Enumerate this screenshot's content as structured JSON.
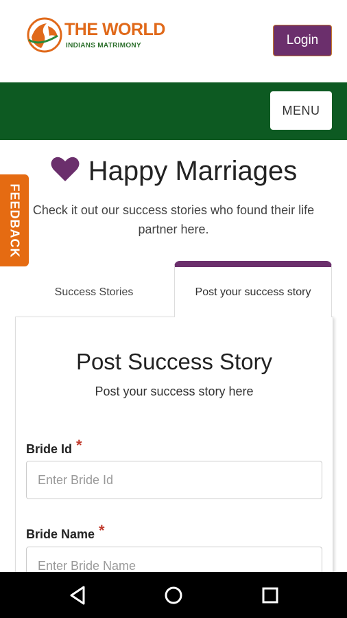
{
  "header": {
    "logo_title": "THE WORLD",
    "logo_subtitle": "INDIANS MATRIMONY",
    "login_label": "Login"
  },
  "navbar": {
    "menu_label": "MENU",
    "color": "#0d5a22"
  },
  "feedback_label": "FEEDBACK",
  "hero": {
    "title": "Happy Marriages",
    "subtitle": "Check it out our success stories who found their life partner here."
  },
  "tabs": [
    {
      "label": "Success Stories",
      "active": false
    },
    {
      "label": "Post your success story",
      "active": true
    }
  ],
  "form": {
    "title": "Post Success Story",
    "subtitle": "Post your success story here",
    "fields": [
      {
        "label": "Bride Id",
        "required_mark": "*",
        "placeholder": "Enter Bride Id",
        "value": ""
      },
      {
        "label": "Bride Name",
        "required_mark": "*",
        "placeholder": "Enter Bride Name",
        "value": ""
      }
    ]
  },
  "system_nav": {
    "icons": [
      "back-icon",
      "home-icon",
      "recents-icon"
    ]
  },
  "colors": {
    "brand_purple": "#6b2f6c",
    "brand_orange": "#e0691a",
    "brand_green": "#0d5a22"
  }
}
